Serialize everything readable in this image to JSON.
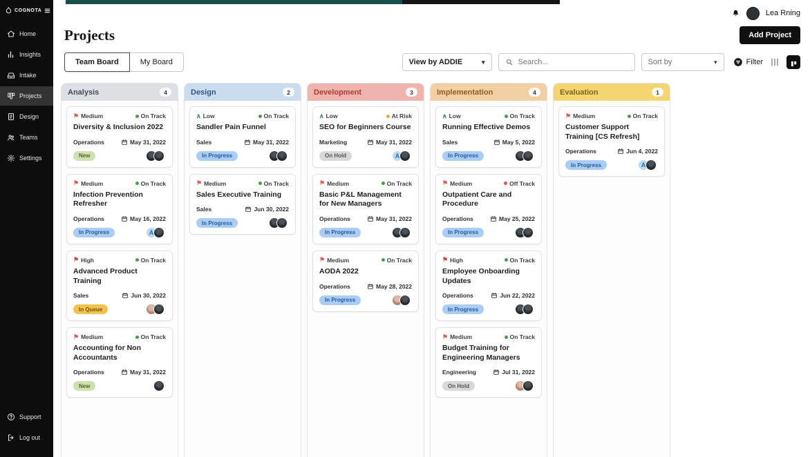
{
  "sidebar": {
    "logo": "COGNOTA",
    "items": [
      {
        "label": "Home",
        "icon": "home",
        "active": false
      },
      {
        "label": "Insights",
        "icon": "insights",
        "active": false
      },
      {
        "label": "Intake",
        "icon": "intake",
        "active": false
      },
      {
        "label": "Projects",
        "icon": "projects",
        "active": true
      },
      {
        "label": "Design",
        "icon": "design",
        "active": false
      },
      {
        "label": "Teams",
        "icon": "teams",
        "active": false
      },
      {
        "label": "Settings",
        "icon": "settings",
        "active": false
      }
    ],
    "footer_items": [
      {
        "label": "Support",
        "icon": "support"
      },
      {
        "label": "Log out",
        "icon": "logout"
      }
    ]
  },
  "topbar": {
    "user_name": "Lea Rning"
  },
  "header": {
    "title": "Projects",
    "add_project_label": "Add Project"
  },
  "toolbar": {
    "tabs": [
      "Team Board",
      "My Board"
    ],
    "active_tab": "Team Board",
    "view_by_label": "View by ADDIE",
    "search_placeholder": "Search...",
    "sort_by_label": "Sort by",
    "filter_label": "Filter"
  },
  "colors": {
    "priority": {
      "Low": "#1f6f66",
      "Medium": "#e05b4b",
      "High": "#d23f3f"
    },
    "track": {
      "On Track": "#43a047",
      "At Risk": "#f2a33c",
      "Off Track": "#e35050"
    },
    "badge": {
      "New": {
        "bg": "#cfdfae",
        "fg": "#55682c"
      },
      "In Progress": {
        "bg": "#a9cdf4",
        "fg": "#29599c"
      },
      "In Queue": {
        "bg": "#f2c44d",
        "fg": "#6e530f"
      },
      "On Hold": {
        "bg": "#d8d8d8",
        "fg": "#555555"
      }
    }
  },
  "board": {
    "columns": [
      {
        "name": "Analysis",
        "count": 4,
        "bg": "#dcdfe3",
        "fg": "#414b55",
        "cards": [
          {
            "priority": "Medium",
            "track": "On Track",
            "title": "Diversity & Inclusion 2022",
            "dept": "Operations",
            "date": "May 31, 2022",
            "badge": "New",
            "avatars": [
              "dark",
              "dark"
            ]
          },
          {
            "priority": "Medium",
            "track": "On Track",
            "title": "Infection Prevention Refresher",
            "dept": "Operations",
            "date": "May 16, 2022",
            "badge": "In Progress",
            "avatars": [
              "A",
              "dark"
            ]
          },
          {
            "priority": "High",
            "track": "On Track",
            "title": "Advanced Product Training",
            "dept": "Sales",
            "date": "Jun 30, 2022",
            "badge": "In Queue",
            "avatars": [
              "light",
              "dark"
            ]
          },
          {
            "priority": "Medium",
            "track": "On Track",
            "title": "Accounting for Non Accountants",
            "dept": "Operations",
            "date": "May 31, 2022",
            "badge": "New",
            "avatars": [
              "dark"
            ]
          }
        ]
      },
      {
        "name": "Design",
        "count": 2,
        "bg": "#cbdcf1",
        "fg": "#33567e",
        "cards": [
          {
            "priority": "Low",
            "track": "On Track",
            "title": "Sandler Pain Funnel",
            "dept": "Sales",
            "date": "May 31, 2022",
            "badge": "In Progress",
            "avatars": [
              "dark",
              "dark"
            ]
          },
          {
            "priority": "Medium",
            "track": "On Track",
            "title": "Sales Executive Training",
            "dept": "Sales",
            "date": "Jun 30, 2022",
            "badge": "In Progress",
            "avatars": [
              "dark",
              "dark"
            ]
          }
        ]
      },
      {
        "name": "Development",
        "count": 3,
        "bg": "#efb4ae",
        "fg": "#ae3c34",
        "cards": [
          {
            "priority": "Low",
            "track": "At Risk",
            "title": "SEO for Beginners Course",
            "dept": "Marketing",
            "date": "May 31, 2022",
            "badge": "On Hold",
            "avatars": [
              "A",
              "dark"
            ]
          },
          {
            "priority": "Medium",
            "track": "On Track",
            "title": "Basic P&L Management for New Managers",
            "dept": "Operations",
            "date": "May 31, 2022",
            "badge": "In Progress",
            "avatars": [
              "dark",
              "dark"
            ]
          },
          {
            "priority": "Medium",
            "track": "On Track",
            "title": "AODA 2022",
            "dept": "Operations",
            "date": "May 28, 2022",
            "badge": "In Progress",
            "avatars": [
              "light",
              "dark"
            ]
          }
        ]
      },
      {
        "name": "Implementation",
        "count": 4,
        "bg": "#f3cfa4",
        "fg": "#96591c",
        "cards": [
          {
            "priority": "Low",
            "track": "On Track",
            "title": "Running Effective Demos",
            "dept": "Sales",
            "date": "May 5, 2022",
            "badge": "In Progress",
            "avatars": [
              "dark",
              "dark"
            ]
          },
          {
            "priority": "Medium",
            "track": "Off Track",
            "title": "Outpatient Care and Procedure",
            "dept": "Operations",
            "date": "May 25, 2022",
            "badge": "In Progress",
            "avatars": [
              "dark",
              "dark"
            ]
          },
          {
            "priority": "High",
            "track": "On Track",
            "title": "Employee Onboarding Updates",
            "dept": "Operations",
            "date": "Jun 22, 2022",
            "badge": "In Progress",
            "avatars": [
              "dark",
              "dark"
            ]
          },
          {
            "priority": "Medium",
            "track": "On Track",
            "title": "Budget Training for Engineering Managers",
            "dept": "Engineering",
            "date": "Jul 31, 2022",
            "badge": "On Hold",
            "avatars": [
              "light",
              "dark"
            ]
          }
        ]
      },
      {
        "name": "Evaluation",
        "count": 1,
        "bg": "#f5d572",
        "fg": "#7d641a",
        "cards": [
          {
            "priority": "Medium",
            "track": "On Track",
            "title": "Customer Support Training [CS Refresh]",
            "dept": "Operations",
            "date": "Jun 4, 2022",
            "badge": "In Progress",
            "avatars": [
              "A",
              "dark"
            ]
          }
        ]
      }
    ]
  }
}
